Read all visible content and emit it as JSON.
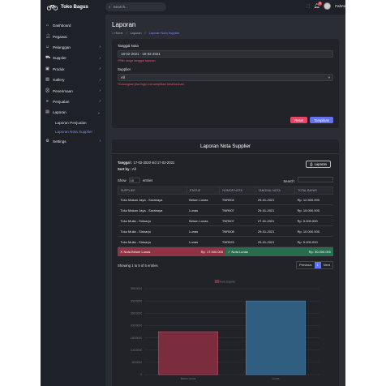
{
  "brand": {
    "name": "Toko Bagus"
  },
  "sidebar": {
    "items": [
      {
        "label": "Dashboard",
        "icon": "home-icon",
        "chevron": false
      },
      {
        "label": "Pegawai",
        "icon": "user-plus-icon",
        "chevron": false
      },
      {
        "label": "Pelanggan",
        "icon": "users-icon",
        "chevron": true
      },
      {
        "label": "Supplier",
        "icon": "truck-icon",
        "chevron": true
      },
      {
        "label": "Produk",
        "icon": "box-icon",
        "chevron": true
      },
      {
        "label": "Gallery",
        "icon": "image-icon",
        "chevron": true
      },
      {
        "label": "Penerimaan",
        "icon": "shopping-cart-icon",
        "chevron": true
      },
      {
        "label": "Penjualan",
        "icon": "receipt-icon",
        "chevron": true
      },
      {
        "label": "Laporan",
        "icon": "document-icon",
        "chevron": true
      }
    ],
    "sub_items": [
      {
        "label": "Laporan Penjualan"
      },
      {
        "label": "Laporan Nota Supplier"
      }
    ],
    "settings": {
      "label": "Settings"
    }
  },
  "topbar": {
    "search_placeholder": "Search...",
    "notif_count": "9",
    "user_name": "Fahmi"
  },
  "page": {
    "title": "Laporan",
    "breadcrumb": [
      "Home",
      "Laporan",
      "Laporan Nota Supplier"
    ]
  },
  "filter": {
    "date_label": "Tanggal Nota",
    "date_value": "18-02-2021 - 18-02-2021",
    "date_help": "*Pilih range tanggal laporan",
    "supplier_label": "Supplier",
    "supplier_value": "All",
    "supplier_help": "*Kosongkan jika ingin menampilkan keseluruhan",
    "reset_label": "Reset",
    "show_label": "Tampilkan"
  },
  "report": {
    "title": "Laporan Nota Supplier",
    "date_range_label": "Tanggal :",
    "date_range_value": "17-02-2020 s/d 17-02-2021",
    "sort_label": "Sort by :",
    "sort_value": "All",
    "print_label": "Laporan",
    "show_label": "Show",
    "entries_value": "10",
    "entries_label": "entries",
    "search_label": "Search:",
    "columns": [
      "SUPPLIER",
      "STATUS",
      "NOMOR NOTA",
      "TANGGAL NOTA",
      "TOTAL BAYAR"
    ],
    "rows": [
      [
        "Toko Makan Jaya - Surabaya",
        "Belum Lunas",
        "TNR004",
        "29-01-2021",
        "Rp. 12.500.000"
      ],
      [
        "Toko Makan Jaya - Surabaya",
        "Lunas",
        "TNR007",
        "29-01-2021",
        "Rp. 15.000.000"
      ],
      [
        "Toko Mulia - Sidoarjo",
        "Belum Lunas",
        "TNR007",
        "27-01-2021",
        "Rp. 5.000.000"
      ],
      [
        "Toko Mulia - Sidoarjo",
        "Lunas",
        "TNR008",
        "29-01-2021",
        "Rp. 10.000.000"
      ],
      [
        "Toko Mulia - Sidoarjo",
        "Lunas",
        "TNR023",
        "29-01-2021",
        "Rp. 5.000.000"
      ]
    ],
    "sum_unpaid_label": "Nota Belum Lunas",
    "sum_unpaid_value": "Rp. 17.500.000",
    "sum_paid_label": "Nota Lunas",
    "sum_paid_value": "Rp. 30.000.000",
    "info": "Showing 1 to 5 of 5 entries",
    "prev_label": "Previous",
    "page_label": "1",
    "next_label": "Next"
  },
  "chart_data": {
    "type": "bar",
    "categories": [
      "Belum Lunas",
      "Lunas"
    ],
    "series": [
      {
        "name": "Nota Supplier",
        "values": [
          17500000,
          30000000
        ],
        "colors": [
          "#7b2d3e",
          "#2f5e80"
        ]
      }
    ],
    "ylim": [
      0,
      35000000
    ],
    "yticks": [
      0,
      5000000,
      10000000,
      15000000,
      20000000,
      25000000,
      30000000,
      35000000
    ],
    "legend": "top"
  },
  "colors": {
    "accent": "#6272f0",
    "danger": "#e54866",
    "success": "#2b6b4e"
  }
}
